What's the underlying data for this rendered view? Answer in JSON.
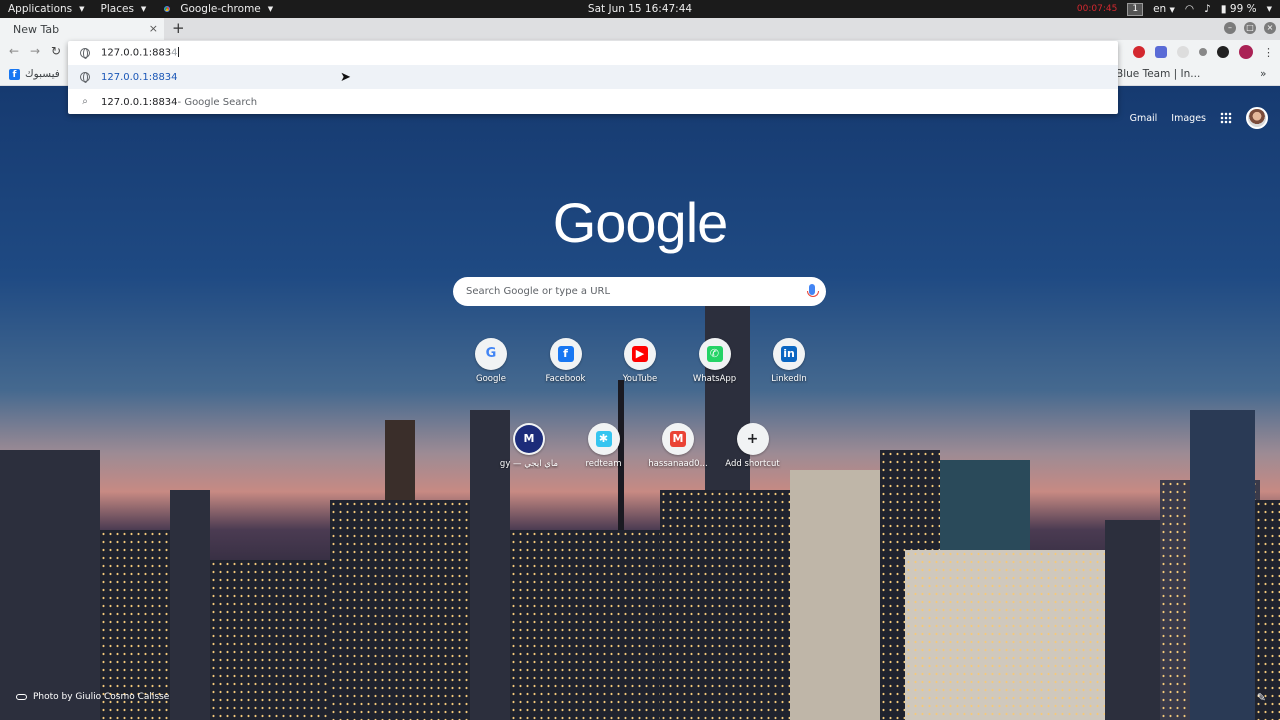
{
  "topbar": {
    "applications": "Applications",
    "places": "Places",
    "app_name": "Google-chrome",
    "clock": "Sat Jun 15  16:47:44",
    "rec_time": "00:07:45",
    "workspace": "1",
    "lang": "en",
    "battery": "99 %"
  },
  "tab": {
    "title": "New Tab",
    "close": "×",
    "new_tab": "+"
  },
  "window_controls": {
    "minimize": "–",
    "maximize": "□",
    "close": "×"
  },
  "bookmarks": {
    "left": {
      "label": "فيسبوك",
      "icon": "f"
    },
    "right": "Blue Team | In..."
  },
  "omnibox": {
    "input_typed": "127.0.0.1:883",
    "input_completion": "4",
    "suggestion_1": "127.0.0.1:8834",
    "suggestion_2_query": "127.0.0.1:8834",
    "suggestion_2_suffix": " - Google Search"
  },
  "ntp": {
    "gmail": "Gmail",
    "images": "Images",
    "logo": "Google",
    "search_placeholder": "Search Google or type a URL",
    "shortcuts_row1": [
      {
        "label": "Google",
        "icon": "G",
        "color": "#4285f4"
      },
      {
        "label": "Facebook",
        "icon": "f",
        "color": "#1877f2"
      },
      {
        "label": "YouTube",
        "icon": "▶",
        "color": "#ff0000"
      },
      {
        "label": "WhatsApp",
        "icon": "✆",
        "color": "#25d366"
      },
      {
        "label": "LinkedIn",
        "icon": "in",
        "color": "#0a66c2"
      }
    ],
    "shortcuts_row2": [
      {
        "label": "gy — ماي ايجي",
        "icon": "M",
        "color": "#1c2c7a"
      },
      {
        "label": "redteam",
        "icon": "✱",
        "color": "#36c5f0"
      },
      {
        "label": "hassanaad0...",
        "icon": "M",
        "color": "#ea4335"
      },
      {
        "label": "Add shortcut",
        "icon": "+",
        "color": "#202124"
      }
    ],
    "photo_credit": "Photo by Giulio Cosmo Calisse"
  }
}
